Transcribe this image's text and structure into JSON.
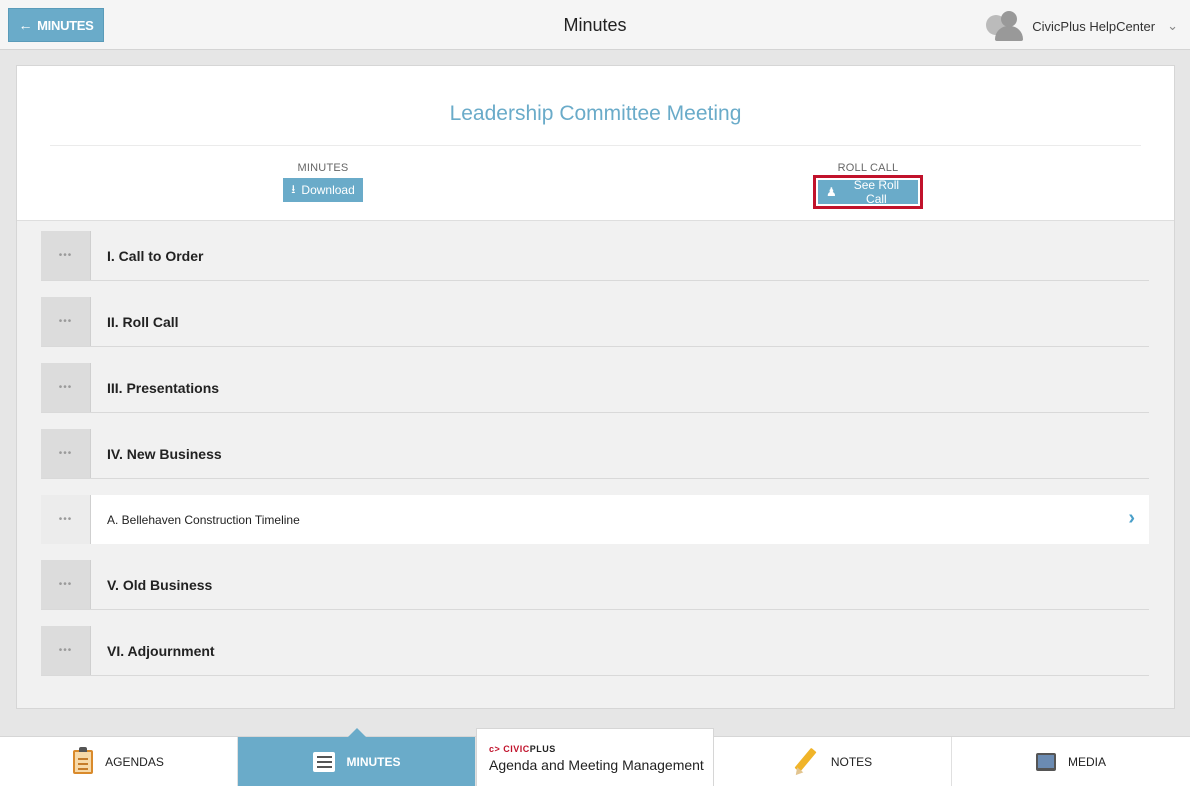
{
  "header": {
    "back_label": "MINUTES",
    "title": "Minutes",
    "user_name": "CivicPlus HelpCenter"
  },
  "meeting": {
    "title": "Leadership Committee Meeting",
    "minutes_label": "MINUTES",
    "download_label": "Download",
    "rollcall_label": "ROLL CALL",
    "see_rollcall_label": "See Roll Call"
  },
  "agenda_items": [
    {
      "label": "I. Call to Order",
      "sub": false
    },
    {
      "label": "II. Roll Call",
      "sub": false
    },
    {
      "label": "III. Presentations",
      "sub": false
    },
    {
      "label": "IV. New Business",
      "sub": false
    },
    {
      "label": "A. Bellehaven Construction Timeline",
      "sub": true
    },
    {
      "label": "V. Old Business",
      "sub": false
    },
    {
      "label": "VI. Adjournment",
      "sub": false
    }
  ],
  "bottom_nav": {
    "agendas": "AGENDAS",
    "minutes": "MINUTES",
    "brand_logo_red": "c> CIVIC",
    "brand_logo_dark": "PLUS",
    "brand_text": "Agenda and Meeting Management",
    "notes": "NOTES",
    "media": "MEDIA"
  },
  "colors": {
    "accent": "#6aabc9",
    "highlight_outline": "#c1122b"
  }
}
